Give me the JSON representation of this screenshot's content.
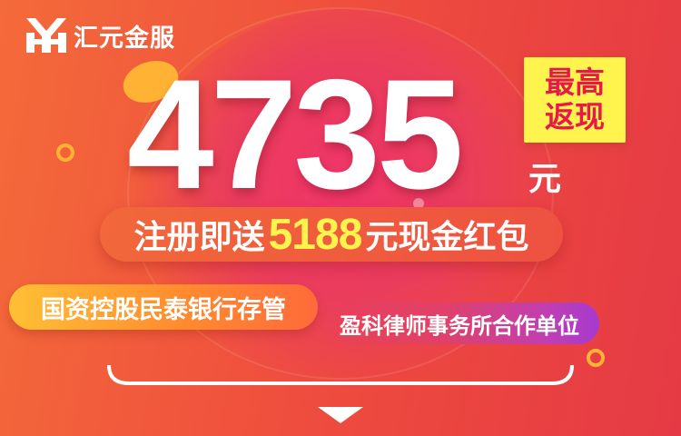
{
  "brand": {
    "name": "汇元金服",
    "logo_icon": "hy-monogram-logo"
  },
  "hero": {
    "amount": "4735",
    "unit": "元",
    "tag_line1": "最高",
    "tag_line2": "返现"
  },
  "promo": {
    "prefix": "注册即送",
    "amount": "5188",
    "suffix": "元现金红包"
  },
  "badges": {
    "bank": "国资控股民泰银行存管",
    "law": "盈科律师事务所合作单位"
  },
  "colors": {
    "background": "#ee4a3e",
    "accent_yellow": "#fff34d",
    "tag_text": "#e8194a",
    "coin": "#ffb233",
    "badge_purple": "#a63ad0"
  }
}
